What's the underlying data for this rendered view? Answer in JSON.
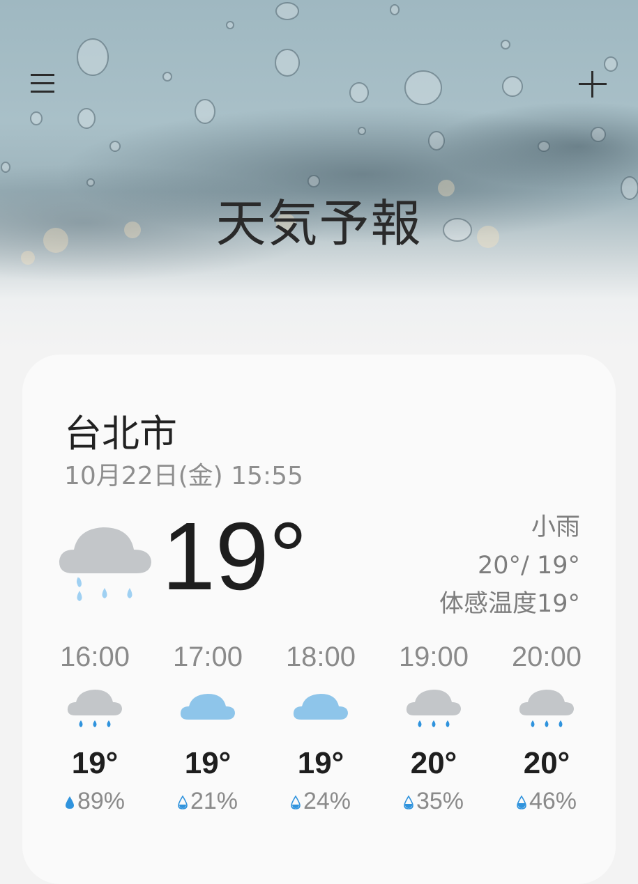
{
  "header": {
    "title": "天気予報"
  },
  "current": {
    "city": "台北市",
    "datetime": "10月22日(金) 15:55",
    "temperature": "19°",
    "condition": "小雨",
    "high_low": "20°/ 19°",
    "feels_like": "体感温度19°",
    "icon": "cloud-rain-icon"
  },
  "hourly": [
    {
      "time": "16:00",
      "temp": "19°",
      "precip": "89%",
      "icon": "cloud-rain-icon"
    },
    {
      "time": "17:00",
      "temp": "19°",
      "precip": "21%",
      "icon": "cloud-icon"
    },
    {
      "time": "18:00",
      "temp": "19°",
      "precip": "24%",
      "icon": "cloud-icon"
    },
    {
      "time": "19:00",
      "temp": "20°",
      "precip": "35%",
      "icon": "cloud-rain-icon"
    },
    {
      "time": "20:00",
      "temp": "20°",
      "precip": "46%",
      "icon": "cloud-rain-icon"
    }
  ],
  "colors": {
    "rain_cloud": "#c3c6c9",
    "cloud_blue": "#8ec5ea",
    "rain_drop": "#2f93dd",
    "light_drop": "#9fd0f2"
  }
}
